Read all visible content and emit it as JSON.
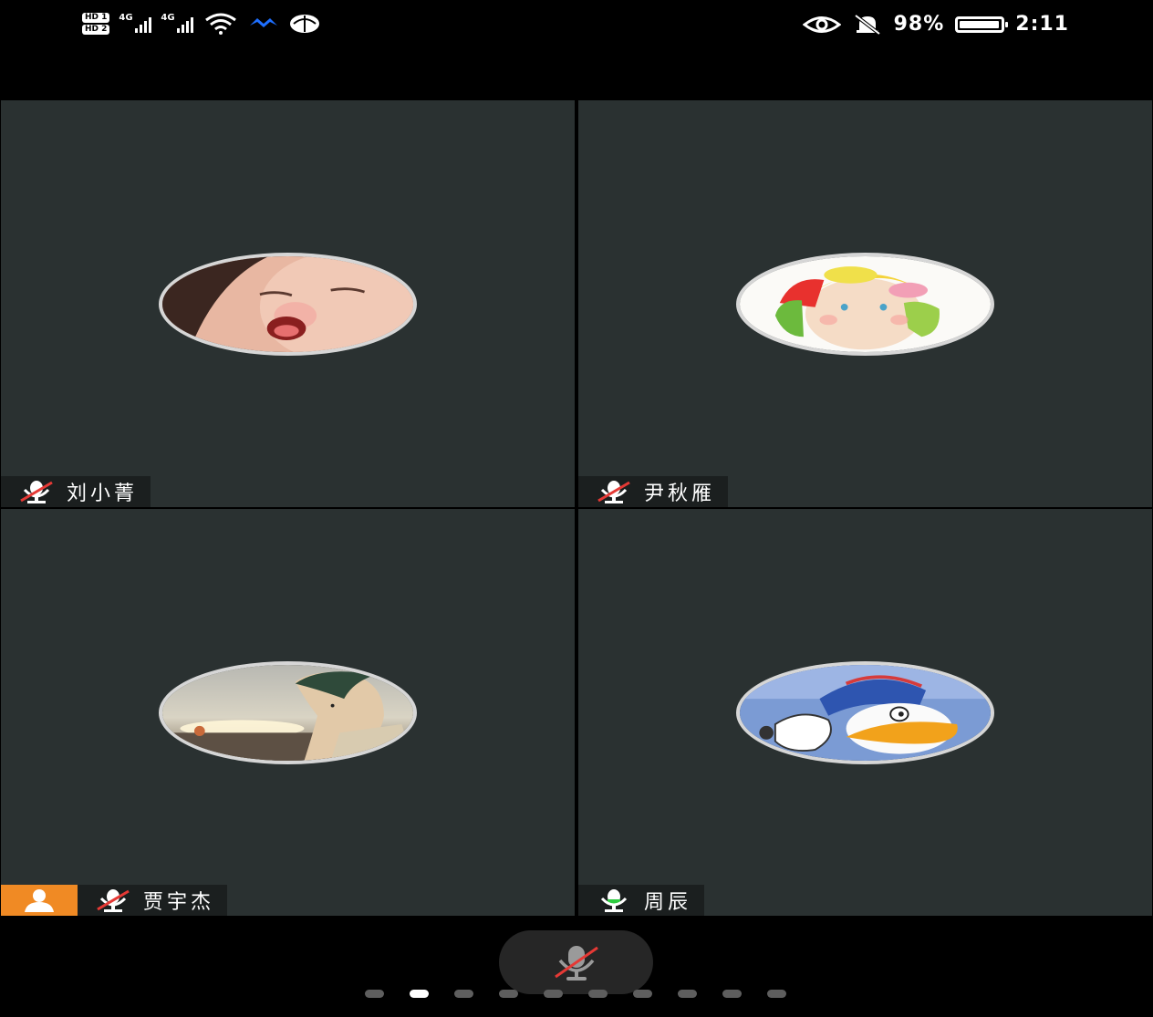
{
  "status_bar": {
    "left_badges": [
      "HD 1",
      "HD 2"
    ],
    "network_1": "4G",
    "network_2": "4G",
    "battery_text": "98%",
    "battery_level": 0.98,
    "time": "2:11"
  },
  "participants": [
    {
      "name": "刘小菁",
      "muted": true,
      "host": false,
      "avatar": "baby-photo"
    },
    {
      "name": "尹秋雁",
      "muted": true,
      "host": false,
      "avatar": "cartoon-girl-drawing"
    },
    {
      "name": "贾宇杰",
      "muted": true,
      "host": true,
      "avatar": "anime-boy-sunset"
    },
    {
      "name": "周辰",
      "muted": false,
      "host": false,
      "avatar": "donald-duck"
    }
  ],
  "controls": {
    "main_mic_muted": true,
    "mic_icon": "mic-muted-icon",
    "active_mic_color": "#2ecc40",
    "muted_slash_color": "#e53935",
    "host_badge_color": "#f08a24"
  },
  "pager": {
    "pages": 10,
    "current": 2
  }
}
